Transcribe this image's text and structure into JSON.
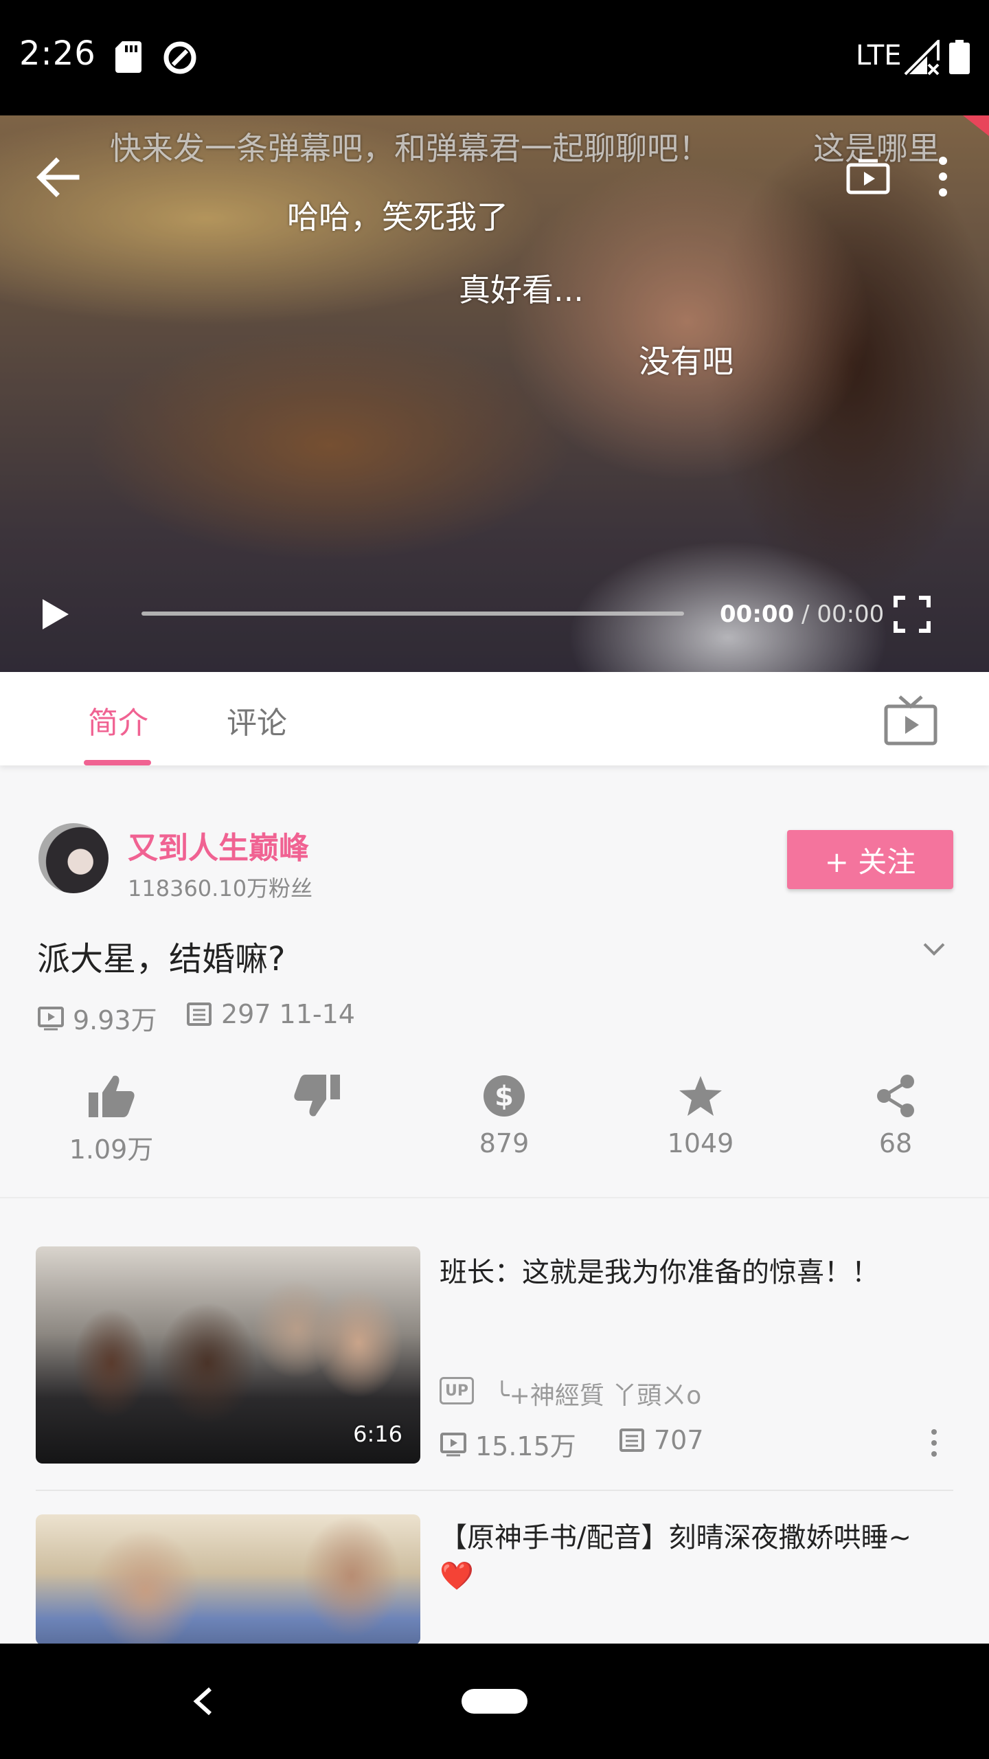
{
  "status_bar": {
    "time": "2:26",
    "network": "LTE",
    "icons": [
      "sd-card-icon",
      "data-saver-icon",
      "signal-icon",
      "battery-icon"
    ]
  },
  "player": {
    "danmaku": [
      "快来发一条弹幕吧，和弹幕君一起聊聊吧！",
      "这是哪里",
      "哈哈，笑死我了",
      "真好看...",
      "没有吧"
    ],
    "current_time": "00:00",
    "separator": " / ",
    "total_time": "00:00",
    "progress": 0
  },
  "tabs": [
    {
      "label": "简介",
      "active": true
    },
    {
      "label": "评论",
      "active": false
    }
  ],
  "uploader": {
    "name": "又到人生巅峰",
    "fans": "118360.10万粉丝",
    "follow_label": "+ 关注"
  },
  "video": {
    "title": "派大星，结婚嘛?",
    "views": "9.93万",
    "danmaku_count": "297",
    "date": "11-14"
  },
  "actions": [
    {
      "name": "like",
      "icon": "thumbs-up-icon",
      "count": "1.09万"
    },
    {
      "name": "dislike",
      "icon": "thumbs-down-icon",
      "count": ""
    },
    {
      "name": "coin",
      "icon": "coin-icon",
      "count": "879"
    },
    {
      "name": "favorite",
      "icon": "star-icon",
      "count": "1049"
    },
    {
      "name": "share",
      "icon": "share-icon",
      "count": "68"
    }
  ],
  "related": [
    {
      "title": "班长：这就是我为你准备的惊喜！！",
      "duration": "6:16",
      "up_badge": "UP",
      "author": "╰+神經質 丫頭ㄨo",
      "views": "15.15万",
      "danmaku": "707"
    },
    {
      "title": "【原神手书/配音】刻晴深夜撒娇哄睡~❤️",
      "duration": "",
      "up_badge": "",
      "author": "",
      "views": "",
      "danmaku": ""
    }
  ],
  "colors": {
    "accent": "#f06292",
    "follow_bg": "#f4749d",
    "muted": "#8a8a8a"
  }
}
